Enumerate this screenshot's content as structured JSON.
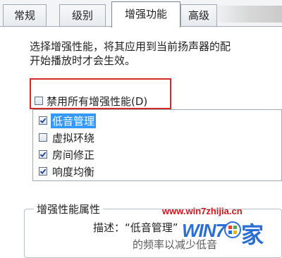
{
  "tabs": [
    {
      "label": "常规",
      "active": false
    },
    {
      "label": "级别",
      "active": false
    },
    {
      "label": "增强功能",
      "active": true
    },
    {
      "label": "高级",
      "active": false
    }
  ],
  "description": {
    "line1": "选择增强性能，将其应用到当前扬声器的配",
    "line2": "开始播放时才会生效。"
  },
  "disable_all": {
    "label": "禁用所有增强性能(D)",
    "checked": false
  },
  "enhancements": [
    {
      "label": "低音管理",
      "checked": true,
      "selected": true
    },
    {
      "label": "虚拟环绕",
      "checked": false,
      "selected": false
    },
    {
      "label": "房间修正",
      "checked": true,
      "selected": false
    },
    {
      "label": "响度均衡",
      "checked": true,
      "selected": false
    }
  ],
  "properties": {
    "title": "增强性能属性",
    "description_line": "描述：“低音管理”",
    "description_line2": "的频率以减少低音"
  },
  "watermark": {
    "url": "www.win7zhijia.cn",
    "logo_text": "WIN7",
    "logo_char": "家"
  },
  "colors": {
    "highlight_box": "#cf2b2b",
    "selection": "#3399ff",
    "watermark_red": "#d4161c",
    "watermark_blue": "#2b6fd4"
  }
}
